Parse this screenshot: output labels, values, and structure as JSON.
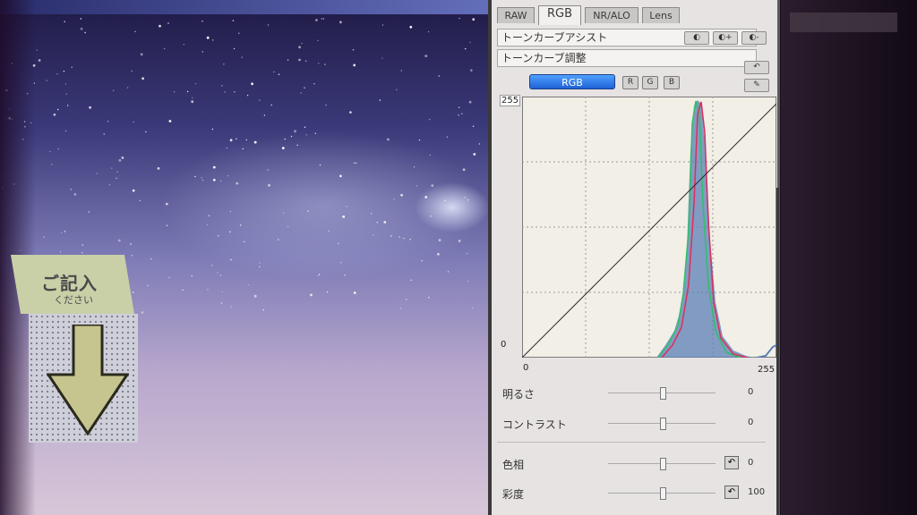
{
  "sign": {
    "title": "ご記入",
    "subtitle": "ください"
  },
  "tabs": [
    {
      "label": "RAW"
    },
    {
      "label": "RGB"
    },
    {
      "label": "NR/ALO"
    },
    {
      "label": "Lens"
    }
  ],
  "tone_assist": {
    "label": "トーンカーブアシスト"
  },
  "tone_adjust": {
    "label": "トーンカーブ調整"
  },
  "channel": {
    "rgb": "RGB",
    "r": "R",
    "g": "G",
    "b": "B"
  },
  "graph": {
    "y_max": "255",
    "y_min": "0",
    "x_min": "0",
    "x_max": "255"
  },
  "sliders": [
    {
      "label": "明るさ",
      "value": "0"
    },
    {
      "label": "コントラスト",
      "value": "0"
    },
    {
      "label": "色相",
      "value": "0"
    },
    {
      "label": "彩度",
      "value": "100"
    }
  ],
  "icons": {
    "reset": "undo-icon",
    "auto": "auto-icon",
    "plus": "plus-icon",
    "minus": "minus-icon",
    "eyedropper": "eyedropper-icon"
  },
  "colors": {
    "accent": "#1f62d6",
    "red_line": "#d9305a",
    "green_line": "#2fbf6a",
    "blue_fill": "#5c7fb5"
  }
}
